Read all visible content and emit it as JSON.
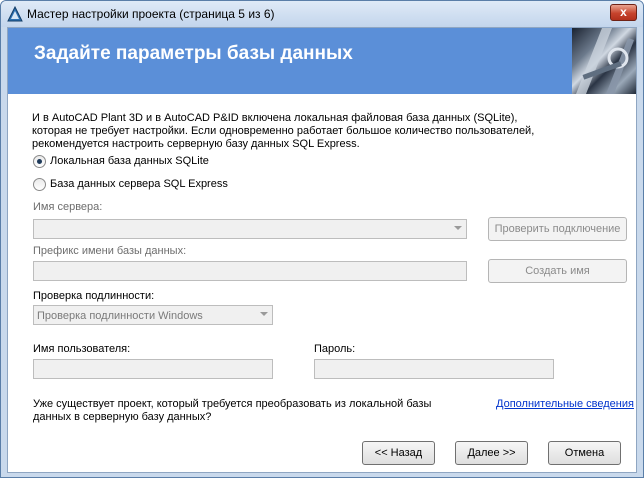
{
  "window": {
    "title": "Мастер настройки проекта (страница 5 из 6)",
    "close_glyph": "x"
  },
  "banner": {
    "title": "Задайте параметры базы данных"
  },
  "description": {
    "line1": "И в AutoCAD Plant 3D и в AutoCAD P&ID включена локальная файловая база данных (SQLite),",
    "line2": "которая не требует настройки. Если одновременно работает большое количество пользователей,",
    "line3": "рекомендуется настроить серверную базу данных SQL Express."
  },
  "options": {
    "sqlite_label": "Локальная база данных SQLite",
    "sqlexpress_label": "База данных сервера SQL Express",
    "selected": "sqlite"
  },
  "server": {
    "label": "Имя сервера:",
    "value": "",
    "verify_button": "Проверить подключение"
  },
  "prefix": {
    "label": "Префикс имени базы данных:",
    "value": "",
    "create_button": "Создать имя"
  },
  "auth": {
    "label": "Проверка подлинности:",
    "value": "Проверка подлинности Windows"
  },
  "username": {
    "label": "Имя пользователя:",
    "value": ""
  },
  "password": {
    "label": "Пароль:",
    "value": ""
  },
  "convert": {
    "question_line1": "Уже существует проект, который требуется преобразовать из локальной базы",
    "question_line2": "данных в серверную базу данных?",
    "more_info_link": "Дополнительные сведения"
  },
  "footer": {
    "back": "<< Назад",
    "next": "Далее >>",
    "cancel": "Отмена"
  },
  "colors": {
    "banner": "#5b8fd8",
    "link": "#0033cc"
  }
}
